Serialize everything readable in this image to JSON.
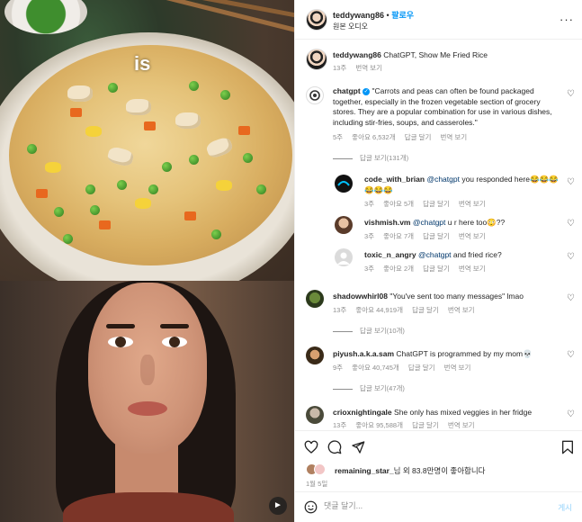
{
  "media": {
    "overlay_word": "is",
    "mute_icon": "speaker-icon"
  },
  "header": {
    "username": "teddywang86",
    "dot": "•",
    "follow_label": "팔로우",
    "audio_label": "원본 오디오",
    "more_icon": "more-horizontal-icon"
  },
  "caption": {
    "username": "teddywang86",
    "text": "ChatGPT, Show Me Fried Rice",
    "time": "13주",
    "translate": "번역 보기"
  },
  "comments": [
    {
      "username": "chatgpt",
      "verified": true,
      "text": "\"Carrots and peas can often be found packaged together, especially in the frozen vegetable section of grocery stores. They are a popular combination for use in various dishes, including stir-fries, soups, and casseroles.\"",
      "time": "5주",
      "likes": "좋아요 6,532개",
      "reply": "답글 달기",
      "translate": "번역 보기",
      "view_replies": "답글 보기(131개)",
      "replies": [
        {
          "username": "code_with_brian",
          "mention": "@chatgpt",
          "text": " you responded here😂😂😂😂😂😂",
          "time": "3주",
          "likes": "좋아요 5개",
          "reply": "답글 달기",
          "translate": "번역 보기"
        },
        {
          "username": "vishmish.vm",
          "mention": "@chatgpt",
          "text": " u r here too😳??",
          "time": "3주",
          "likes": "좋아요 7개",
          "reply": "답글 달기",
          "translate": "번역 보기"
        },
        {
          "username": "toxic_n_angry",
          "mention": "@chatgpt",
          "text": " and fried rice?",
          "time": "3주",
          "likes": "좋아요 2개",
          "reply": "답글 달기",
          "translate": "번역 보기"
        }
      ]
    },
    {
      "username": "shadowwhirl08",
      "text": "\"You've sent too many messages\" lmao",
      "time": "13주",
      "likes": "좋아요 44,919개",
      "reply": "답글 달기",
      "translate": "번역 보기",
      "view_replies": "답글 보기(10개)"
    },
    {
      "username": "piyush.a.k.a.sam",
      "text": "ChatGPT is programmed by my mom💀",
      "time": "9주",
      "likes": "좋아요 40,745개",
      "reply": "답글 달기",
      "translate": "번역 보기",
      "view_replies": "답글 보기(47개)"
    },
    {
      "username": "crioxnightingale",
      "text": "She only has mixed veggies in her fridge",
      "time": "13주",
      "likes": "좋아요 95,588개",
      "reply": "답글 달기",
      "translate": "번역 보기"
    }
  ],
  "actions": {
    "liked_by_user": "remaining_star_",
    "liked_by_rest": "님 외 83.8만명이 좋아합니다",
    "date": "1월 5일"
  },
  "comment_box": {
    "placeholder": "댓글 달기...",
    "post_label": "게시"
  }
}
